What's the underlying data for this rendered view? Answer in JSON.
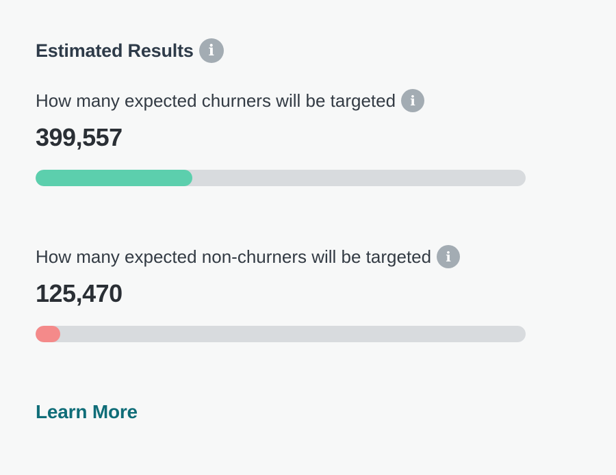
{
  "section": {
    "title": "Estimated Results",
    "info_icon_glyph": "i"
  },
  "metrics": [
    {
      "label": "How many expected churners will be targeted",
      "value": "399,557",
      "progress_fraction": 0.32,
      "bar_color": "#5ccfad",
      "info_icon_glyph": "i"
    },
    {
      "label": "How many expected non-churners will be targeted",
      "value": "125,470",
      "progress_fraction": 0.05,
      "bar_color": "#f48a8a",
      "info_icon_glyph": "i"
    }
  ],
  "links": {
    "learn_more": "Learn More"
  },
  "colors": {
    "background": "#f7f8f8",
    "track": "#d8dbde",
    "link": "#0f6d78",
    "info_icon": "#a3acb3"
  }
}
